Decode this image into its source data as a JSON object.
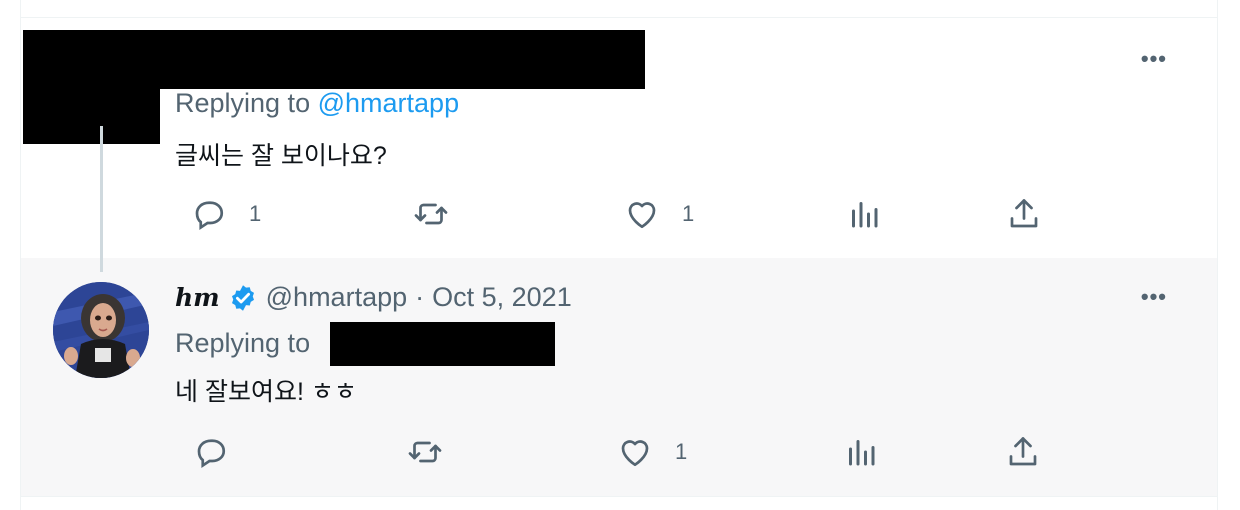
{
  "colors": {
    "accent": "#1d9bf0",
    "muted": "#536471",
    "text": "#0f1419",
    "highlight_bg": "#f7f7f8",
    "redaction": "#000000"
  },
  "tweet_parent": {
    "replying_prefix": "Replying to",
    "replying_to": "@hmartapp",
    "text": "글씨는 잘 보이나요?",
    "more_icon": "more-horizontal-icon",
    "actions": {
      "reply_count": "1",
      "retweet_count": "",
      "like_count": "1",
      "views_count": ""
    }
  },
  "tweet_reply": {
    "display_name": "hm",
    "verified": true,
    "handle": "@hmartapp",
    "separator": "·",
    "date": "Oct 5, 2021",
    "replying_prefix": "Replying to",
    "text": "네 잘보여요! ㅎㅎ",
    "more_icon": "more-horizontal-icon",
    "actions": {
      "reply_count": "",
      "retweet_count": "",
      "like_count": "1",
      "views_count": ""
    }
  }
}
